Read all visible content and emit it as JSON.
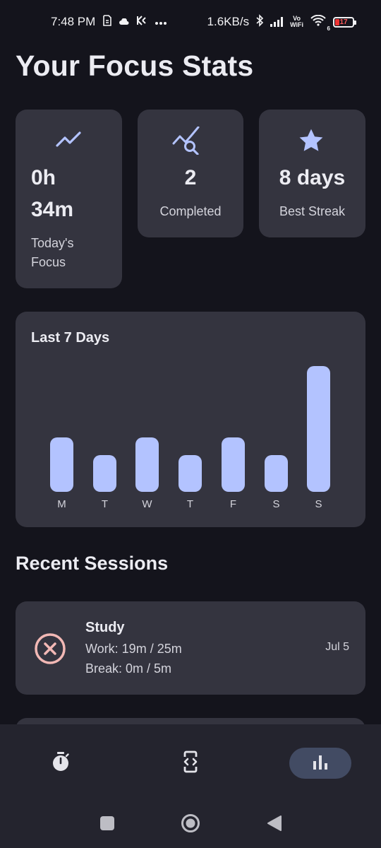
{
  "status_bar": {
    "time": "7:48 PM",
    "speed": "1.6KB/s",
    "volte_top": "Vo",
    "volte_bottom": "WiFi",
    "wifi_sub": "6",
    "battery": "17"
  },
  "page": {
    "title": "Your Focus Stats"
  },
  "stats": {
    "focus": {
      "value_hours": "0h",
      "value_minutes": "34m",
      "label_line1": "Today's",
      "label_line2": "Focus",
      "icon": "trending-up-icon"
    },
    "completed": {
      "value": "2",
      "label": "Completed",
      "icon": "query-stats-icon"
    },
    "streak": {
      "value": "8 days",
      "label": "Best Streak",
      "icon": "star-icon"
    }
  },
  "chart_data": {
    "type": "bar",
    "title": "Last 7 Days",
    "categories": [
      "M",
      "T",
      "W",
      "T",
      "F",
      "S",
      "S"
    ],
    "values": [
      30,
      20,
      30,
      20,
      30,
      20,
      69
    ],
    "ylim": [
      0,
      69
    ],
    "grid": false,
    "color": "#b3c3ff"
  },
  "recent": {
    "title": "Recent Sessions",
    "sessions": [
      {
        "title": "Study",
        "work": "Work: 19m / 25m",
        "break": "Break: 0m / 5m",
        "date": "Jul 5",
        "status_icon": "cancel-circle-icon",
        "status_color": "#f2b8b5"
      }
    ]
  },
  "bottom_nav": {
    "items": [
      {
        "icon": "timer-icon",
        "active": false
      },
      {
        "icon": "app-code-icon",
        "active": false
      },
      {
        "icon": "bar-chart-icon",
        "active": true
      }
    ]
  },
  "colors": {
    "background": "#14141c",
    "card": "#34343f",
    "accent": "#b3c3ff",
    "nav_active": "#424b63",
    "nav_bar": "#24242e"
  }
}
